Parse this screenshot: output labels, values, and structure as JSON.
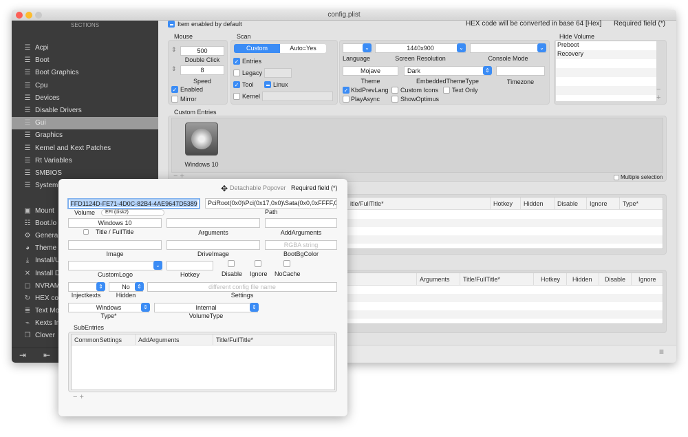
{
  "window": {
    "title": "config.plist"
  },
  "sidebar": {
    "header": "SECTIONS",
    "items": [
      {
        "label": "Acpi"
      },
      {
        "label": "Boot"
      },
      {
        "label": "Boot Graphics"
      },
      {
        "label": "Cpu"
      },
      {
        "label": "Devices"
      },
      {
        "label": "Disable Drivers"
      },
      {
        "label": "Gui",
        "selected": true
      },
      {
        "label": "Graphics"
      },
      {
        "label": "Kernel and Kext Patches"
      },
      {
        "label": "Rt Variables"
      },
      {
        "label": "SMBIOS"
      },
      {
        "label": "System Parameters"
      }
    ],
    "tools": [
      {
        "label": "Mount",
        "icon": "disk-icon"
      },
      {
        "label": "Boot.lo",
        "icon": "log-icon"
      },
      {
        "label": "Genera",
        "icon": "gears-icon"
      },
      {
        "label": "Theme",
        "icon": "palette-icon"
      },
      {
        "label": "Install/U",
        "icon": "download-icon"
      },
      {
        "label": "Install D",
        "icon": "tools-icon"
      },
      {
        "label": "NVRAM",
        "icon": "chip-icon"
      },
      {
        "label": "HEX co",
        "icon": "refresh-icon"
      },
      {
        "label": "Text Mo",
        "icon": "text-icon"
      },
      {
        "label": "Kexts In",
        "icon": "plug-icon"
      },
      {
        "label": "Clover",
        "icon": "copy-icon"
      }
    ]
  },
  "header": {
    "item_enabled": "Item enabled by default",
    "hex_note": "HEX code will be converted in base 64 [Hex]",
    "required": "Required field (*)"
  },
  "mouse": {
    "title": "Mouse",
    "double_click": "500",
    "double_click_label": "Double Click",
    "speed": "8",
    "speed_label": "Speed",
    "enabled": "Enabled",
    "mirror": "Mirror"
  },
  "scan": {
    "title": "Scan",
    "seg_custom": "Custom",
    "seg_auto": "Auto=Yes",
    "entries": "Entries",
    "legacy": "Legacy",
    "tool": "Tool",
    "linux": "Linux",
    "kernel": "Kernel"
  },
  "display": {
    "language_label": "Language",
    "resolution": "1440x900",
    "resolution_label": "Screen Resolution",
    "console_label": "Console Mode",
    "theme": "Mojave",
    "theme_label": "Theme",
    "embedded": "Dark",
    "embedded_label": "EmbeddedThemeType",
    "timezone_label": "Timezone",
    "kbd": "KbdPrevLang",
    "custom_icons": "Custom Icons",
    "text_only": "Text Only",
    "play_async": "PlayAsync",
    "show_optimus": "ShowOptimus"
  },
  "hide_volume": {
    "title": "Hide Volume",
    "items": [
      "Preboot",
      "Recovery"
    ]
  },
  "custom_entries": {
    "title": "Custom Entries",
    "entry": "Windows 10",
    "multiple": "Multiple selection"
  },
  "table1": {
    "headers": [
      "itle/FullTitle*",
      "Hotkey",
      "Hidden",
      "Disable",
      "Ignore",
      "Type*"
    ]
  },
  "table2": {
    "headers": [
      "Arguments",
      "Title/FullTitle*",
      "Hotkey",
      "Hidden",
      "Disable",
      "Ignore"
    ]
  },
  "popover": {
    "detach": "Detachable Popover",
    "required": "Required field (*)",
    "volume_value": "FFD1124D-FE71-4D0C-82B4-4AE9647D5389",
    "path_value": "PciRoot(0x0)\\Pci(0x17,0x0)\\Sata(0x0,0xFFFF,0x",
    "volume_label": "Volume",
    "volume_select": "EFI (disk2)",
    "path_label": "Path",
    "title_value": "Windows 10",
    "title_label": "Title / FullTitle",
    "arguments_label": "Arguments",
    "addargs_label": "AddArguments",
    "image_label": "Image",
    "driveimage_label": "DriveImage",
    "bgcolor_placeholder": "RGBA string",
    "bgcolor_label": "BootBgColor",
    "customlogo_label": "CustomLogo",
    "hotkey_label": "Hotkey",
    "disable_label": "Disable",
    "ignore_label": "Ignore",
    "nocache_label": "NoCache",
    "injectkexts_label": "Injectkexts",
    "hidden_value": "No",
    "hidden_label": "Hidden",
    "settings_placeholder": "different config file name",
    "settings_label": "Settings",
    "type_value": "Windows",
    "type_label": "Type*",
    "voltype_value": "Internal",
    "voltype_label": "VolumeType",
    "subentries_label": "SubEntries",
    "sub_headers": [
      "CommonSettings",
      "AddArguments",
      "Title/FullTitle*"
    ]
  },
  "colors": {
    "accent": "#3b8cf5",
    "sidebar": "#3b3b3b",
    "selected": "#9b9b9b"
  }
}
